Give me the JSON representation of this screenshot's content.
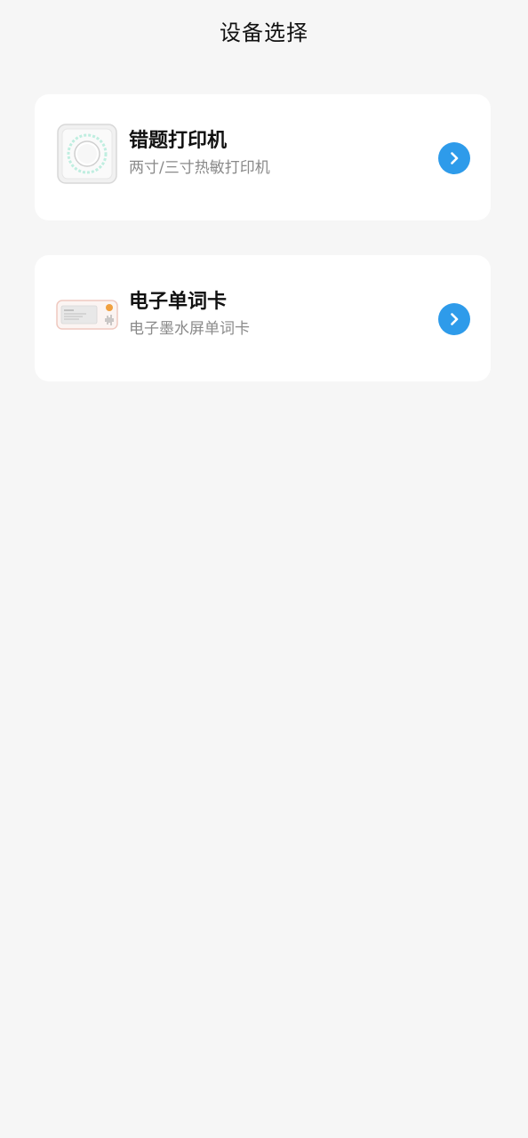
{
  "header": {
    "title": "设备选择"
  },
  "devices": [
    {
      "title": "错题打印机",
      "subtitle": "两寸/三寸热敏打印机",
      "icon": "thermal-printer-icon"
    },
    {
      "title": "电子单词卡",
      "subtitle": "电子墨水屏单词卡",
      "icon": "e-ink-word-card-icon"
    }
  ],
  "colors": {
    "background": "#f6f6f6",
    "card": "#ffffff",
    "accent": "#2e9bea",
    "title": "#111111",
    "subtitle": "#8a8a8a"
  }
}
